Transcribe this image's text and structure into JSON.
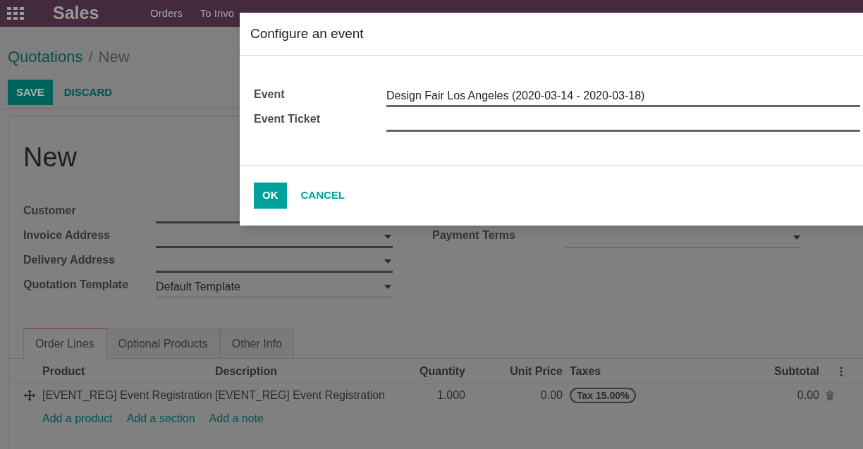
{
  "navbar": {
    "app": "Sales",
    "menu": [
      "Orders",
      "To Invo"
    ]
  },
  "breadcrumb": {
    "parent": "Quotations",
    "separator": "/",
    "current": "New"
  },
  "actions": {
    "primary": "SAVE",
    "secondary": "DISCARD"
  },
  "record": {
    "title": "New",
    "fields_left": [
      {
        "label": "Customer",
        "required": true,
        "dropdown": false
      },
      {
        "label": "Invoice Address",
        "required": true,
        "dropdown": true
      },
      {
        "label": "Delivery Address",
        "required": true,
        "dropdown": true
      },
      {
        "label": "Quotation Template",
        "required": false,
        "dropdown": true,
        "value": "Default Template"
      }
    ],
    "fields_right": [
      {
        "label": "Payment Terms",
        "required": false,
        "dropdown": true
      }
    ]
  },
  "tabs": [
    {
      "label": "Order Lines",
      "selected": true
    },
    {
      "label": "Optional Products",
      "selected": false
    },
    {
      "label": "Other Info",
      "selected": false
    }
  ],
  "table": {
    "columns": [
      "Product",
      "Description",
      "Quantity",
      "Unit Price",
      "Taxes",
      "Subtotal"
    ],
    "rows": [
      {
        "product": "[EVENT_REG] Event Registration",
        "description": "[EVENT_REG] Event Registration",
        "quantity": "1.000",
        "unit_price": "0.00",
        "taxes": "Tax 15.00%",
        "subtotal": "0.00"
      }
    ],
    "add_links": [
      "Add a product",
      "Add a section",
      "Add a note"
    ]
  },
  "dialog": {
    "title": "Configure an event",
    "fields": [
      {
        "label": "Event",
        "value": "Design Fair Los Angeles (2020-03-14 - 2020-03-18)"
      },
      {
        "label": "Event Ticket"
      }
    ],
    "primary": "OK",
    "secondary": "CANCEL"
  }
}
